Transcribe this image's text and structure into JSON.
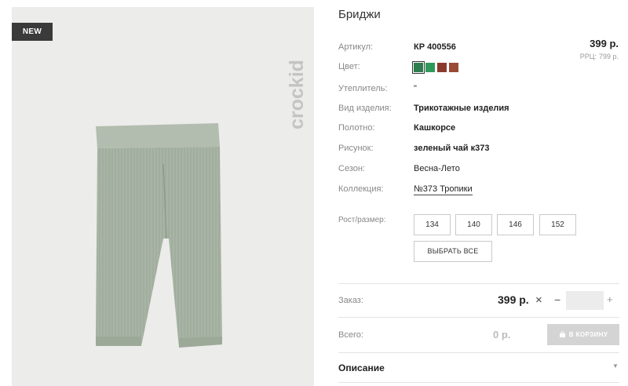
{
  "product": {
    "badge": "NEW",
    "brand": "crockid",
    "title": "Бриджи",
    "price": "399 р.",
    "rrp_label": "РРЦ:",
    "rrp_value": "799 р."
  },
  "attributes": [
    {
      "label": "Артикул:",
      "value": "КР 400556"
    },
    {
      "label": "Цвет:",
      "value": ""
    },
    {
      "label": "Утеплитель:",
      "value": "\""
    },
    {
      "label": "Вид изделия:",
      "value": "Трикотажные изделия"
    },
    {
      "label": "Полотно:",
      "value": "Кашкорсе"
    },
    {
      "label": "Рисунок:",
      "value": "зеленый чай к373"
    },
    {
      "label": "Сезон:",
      "value": "Весна-Лето"
    },
    {
      "label": "Коллекция:",
      "value": "№373 Тропики"
    }
  ],
  "colors": [
    "#2e7d4f",
    "#2f9a5c",
    "#8a3a2c",
    "#9a4a35"
  ],
  "sizes": {
    "label": "Рост/размер:",
    "options": [
      "134",
      "140",
      "146",
      "152"
    ],
    "select_all": "ВЫБРАТЬ ВСЕ"
  },
  "order": {
    "label": "Заказ:",
    "price": "399 р.",
    "times": "×",
    "minus": "−",
    "plus": "+",
    "quantity": ""
  },
  "total": {
    "label": "Всего:",
    "value": "0 р.",
    "cart_button": "В КОРЗИНУ"
  },
  "description": {
    "title": "Описание",
    "chevron": "▼"
  }
}
